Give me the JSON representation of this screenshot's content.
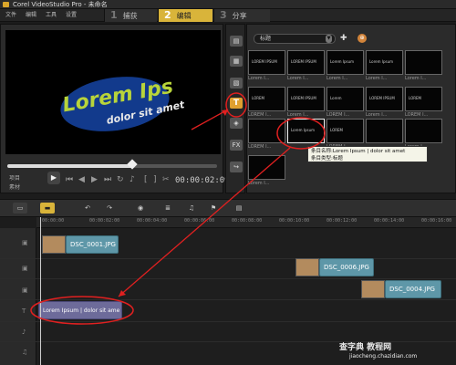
{
  "window": {
    "title": "Corel VideoStudio Pro - 未命名"
  },
  "menu": [
    "文件",
    "编辑",
    "工具",
    "设置"
  ],
  "steps": [
    {
      "num": "1",
      "label": "捕获"
    },
    {
      "num": "2",
      "label": "编辑"
    },
    {
      "num": "3",
      "label": "分享"
    }
  ],
  "preview": {
    "title_text": "Lorem Ips",
    "subtitle_text": "dolor sit amet",
    "mode_project": "项目",
    "mode_clip": "素材",
    "timecode": "00:00:02:09"
  },
  "library": {
    "category": "标题",
    "thumbs": [
      {
        "text": "LOREM IPSUM",
        "label": "Lorem I..."
      },
      {
        "text": "LOREM IPSUM",
        "label": "Lorem I..."
      },
      {
        "text": "Lorem Ipsum",
        "label": "Lorem I..."
      },
      {
        "text": "Lorem Ipsum",
        "label": "Lorem I..."
      },
      {
        "text": "",
        "label": "Lorem I..."
      },
      {
        "text": "LOREM",
        "label": "LOREM I..."
      },
      {
        "text": "LOREM IPSUM",
        "label": "Lorem I..."
      },
      {
        "text": "Lorem",
        "label": "LOREM I..."
      },
      {
        "text": "LOREM IPSUM",
        "label": "Lorem I..."
      },
      {
        "text": "LOREM",
        "label": "LOREM I..."
      },
      {
        "text": "",
        "label": "LOREM I..."
      },
      {
        "text": "Lorem Ipsum",
        "label": ""
      },
      {
        "text": "LOREM",
        "label": "LOREM I..."
      },
      {
        "text": "",
        "label": ""
      },
      {
        "text": "",
        "label": "Lorem I..."
      },
      {
        "text": "",
        "label": "Lorem I..."
      }
    ],
    "tooltip_line1": "条目名称:Lorem Ipsum | dolor sit amet",
    "tooltip_line2": "条目类型:标题"
  },
  "sidestrip": {
    "fx_label": "FX",
    "title_label": "T"
  },
  "ruler": [
    "00:00:00",
    "00:00:02:00",
    "00:00:04:00",
    "00:00:06:00",
    "00:00:08:00",
    "00:00:10:00",
    "00:00:12:00",
    "00:00:14:00",
    "00:00:16:00"
  ],
  "clips": {
    "clip1": "DSC_0001.JPG",
    "clip2": "DSC_0006.JPG",
    "clip3": "DSC_0004.JPG",
    "title_clip": "Lorem Ipsum | dolor sit ame"
  },
  "watermark": {
    "line1": "查字典 教程网",
    "line2": "jiaocheng.chazidian.com"
  },
  "colors": {
    "accent": "#d9b43a",
    "annotation": "#e02020",
    "clip": "#5e97a8",
    "title_clip": "#6d6b9a"
  }
}
